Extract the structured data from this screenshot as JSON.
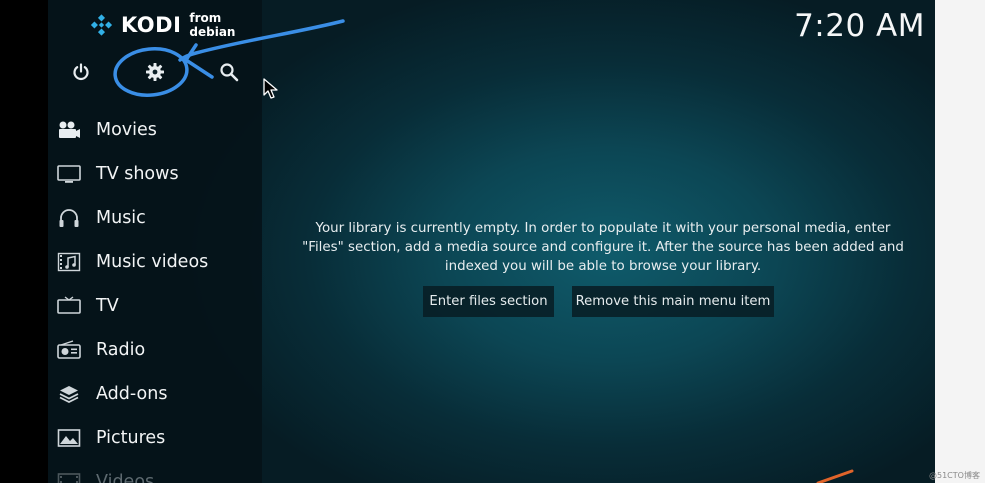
{
  "header": {
    "logo_text": "KODI",
    "logo_sub": "from debian",
    "clock": "7:20 AM"
  },
  "top_icons": [
    {
      "name": "power-icon"
    },
    {
      "name": "gear-icon"
    },
    {
      "name": "search-icon"
    }
  ],
  "menu": {
    "items": [
      {
        "label": "Movies",
        "icon": "movies-icon"
      },
      {
        "label": "TV shows",
        "icon": "tv-shows-icon"
      },
      {
        "label": "Music",
        "icon": "headphones-icon"
      },
      {
        "label": "Music videos",
        "icon": "music-videos-icon"
      },
      {
        "label": "TV",
        "icon": "tv-icon"
      },
      {
        "label": "Radio",
        "icon": "radio-icon"
      },
      {
        "label": "Add-ons",
        "icon": "addons-icon"
      },
      {
        "label": "Pictures",
        "icon": "pictures-icon"
      },
      {
        "label": "Videos",
        "icon": "videos-icon"
      }
    ]
  },
  "main": {
    "message_line1": "Your library is currently empty. In order to populate it with your personal media, enter",
    "message_line2": "\"Files\" section, add a media source and configure it. After the source has been added and",
    "message_line3": "indexed you will be able to browse your library.",
    "enter_files_label": "Enter files section",
    "remove_item_label": "Remove this main menu item"
  },
  "watermark": "@51CTO博客",
  "colors": {
    "background_center": "#0f5b6b",
    "background_edge": "#061c24",
    "sidebar": "#061218",
    "annotation_pen": "#3a8ee6",
    "right_frame": "#f4f4f4"
  }
}
